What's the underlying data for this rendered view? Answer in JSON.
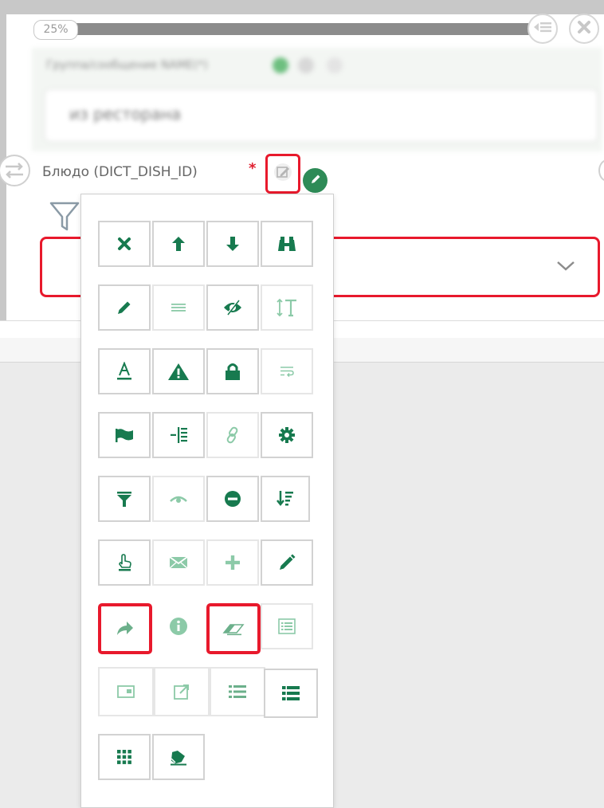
{
  "progress": {
    "label": "25%",
    "value": 0.25
  },
  "header_buttons": {
    "list_icon": "list-icon",
    "close_icon": "close-icon"
  },
  "blurred": {
    "label": "Группа/сообщение NAME(*)",
    "input_value": "из ресторана"
  },
  "field": {
    "label": "Блюдо (DICT_DISH_ID)",
    "required_mark": "*",
    "edit_icon": "edit-icon",
    "indicator_color": "#2e8b57"
  },
  "select": {
    "value": ""
  },
  "colors": {
    "accent_green": "#177a4f",
    "light_green": "#8ccaa8",
    "highlight_red": "#e8192c"
  },
  "toolbar": {
    "rows": [
      [
        "delete-icon",
        "arrow-up-icon",
        "arrow-down-icon",
        "binoculars-icon"
      ],
      [
        "pencil-icon",
        "list-lines-icon",
        "eye-slash-icon",
        "text-height-icon"
      ],
      [
        "text-color-icon",
        "warning-icon",
        "lock-icon",
        "wrap-text-icon"
      ],
      [
        "flag-icon",
        "indent-icon",
        "link-icon",
        "gear-icon"
      ],
      [
        "filter-icon",
        "eye-icon",
        "minus-circle-icon",
        "sort-amount-icon"
      ],
      [
        "pointer-hand-icon",
        "envelope-icon",
        "plus-icon",
        "pen-icon"
      ],
      [
        "share-arrow-icon",
        "info-icon",
        "eraser-icon",
        "list-alt-icon"
      ],
      [
        "window-icon",
        "external-link-icon",
        "list-icon",
        "list-bold-icon"
      ],
      [
        "grid-icon",
        "eraser-fill-icon"
      ]
    ]
  }
}
